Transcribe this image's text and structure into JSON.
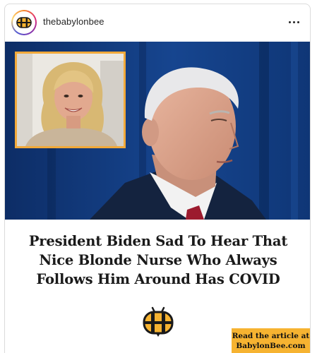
{
  "post": {
    "username": "thebabylonbee",
    "more_icon": "more-horizontal-icon"
  },
  "image": {
    "headline_lines": [
      "President Biden Sad To Hear That",
      "Nice Blonde Nurse Who Always",
      "Follows Him Around Has COVID"
    ],
    "badge_line1": "Read the article at",
    "badge_line2": "BabylonBee.com"
  },
  "colors": {
    "brand_gold": "#f6b331",
    "inset_border": "#f1a93a",
    "photo_background": "#0f3270",
    "headline_text": "#1a1a1a"
  }
}
